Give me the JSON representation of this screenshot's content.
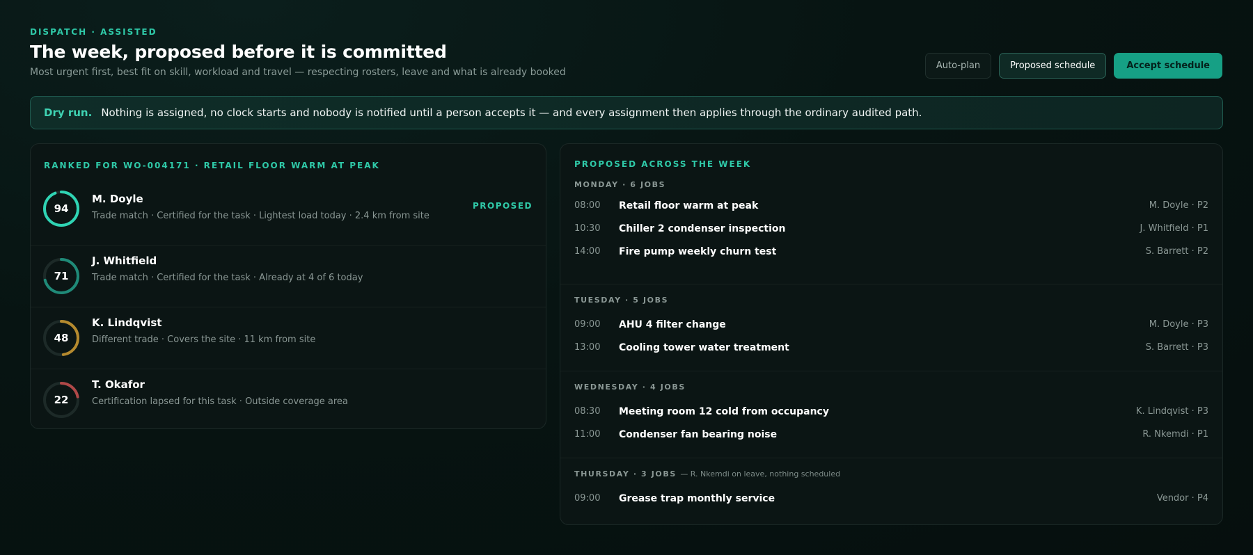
{
  "header": {
    "eyebrow": "DISPATCH · ASSISTED",
    "title": "The week, proposed before it is committed",
    "subtitle": "Most urgent first, best fit on skill, workload and travel — respecting rosters, leave and what is already booked"
  },
  "actions": {
    "auto_plan": "Auto-plan",
    "proposed_schedule": "Proposed schedule",
    "accept_schedule": "Accept schedule"
  },
  "banner": {
    "lead": "Dry run.",
    "message": "Nothing is assigned, no clock starts and nobody is notified until a person accepts it — and every assignment then applies through the ordinary audited path."
  },
  "ranked": {
    "label": "RANKED FOR WO-004171 · RETAIL FLOOR WARM AT PEAK",
    "candidates": [
      {
        "score": "94",
        "score_fraction": 0.94,
        "name": "M. Doyle",
        "detail": "Trade match · Certified for the task · Lightest load today · 2.4 km from site",
        "tag": "PROPOSED",
        "ring_color": "#2fd4b4"
      },
      {
        "score": "71",
        "score_fraction": 0.71,
        "name": "J. Whitfield",
        "detail": "Trade match · Certified for the task · Already at 4 of 6 today",
        "tag": "",
        "ring_color": "#1f8a78"
      },
      {
        "score": "48",
        "score_fraction": 0.48,
        "name": "K. Lindqvist",
        "detail": "Different trade · Covers the site · 11 km from site",
        "tag": "",
        "ring_color": "#b58a2e"
      },
      {
        "score": "22",
        "score_fraction": 0.22,
        "name": "T. Okafor",
        "detail": "Certification lapsed for this task · Outside coverage area",
        "tag": "",
        "ring_color": "#b04848"
      }
    ]
  },
  "week": {
    "label": "PROPOSED ACROSS THE WEEK",
    "days": [
      {
        "head": "MONDAY · 6 JOBS",
        "note": "",
        "jobs": [
          {
            "time": "08:00",
            "title": "Retail floor warm at peak",
            "who": "M. Doyle · P2"
          },
          {
            "time": "10:30",
            "title": "Chiller 2 condenser inspection",
            "who": "J. Whitfield · P1"
          },
          {
            "time": "14:00",
            "title": "Fire pump weekly churn test",
            "who": "S. Barrett · P2"
          }
        ]
      },
      {
        "head": "TUESDAY · 5 JOBS",
        "note": "",
        "jobs": [
          {
            "time": "09:00",
            "title": "AHU 4 filter change",
            "who": "M. Doyle · P3"
          },
          {
            "time": "13:00",
            "title": "Cooling tower water treatment",
            "who": "S. Barrett · P3"
          }
        ]
      },
      {
        "head": "WEDNESDAY · 4 JOBS",
        "note": "",
        "jobs": [
          {
            "time": "08:30",
            "title": "Meeting room 12 cold from occupancy",
            "who": "K. Lindqvist · P3"
          },
          {
            "time": "11:00",
            "title": "Condenser fan bearing noise",
            "who": "R. Nkemdi · P1"
          }
        ]
      },
      {
        "head": "THURSDAY · 3 JOBS",
        "note": "— R. Nkemdi on leave, nothing scheduled",
        "jobs": [
          {
            "time": "09:00",
            "title": "Grease trap monthly service",
            "who": "Vendor · P4"
          }
        ]
      }
    ]
  }
}
